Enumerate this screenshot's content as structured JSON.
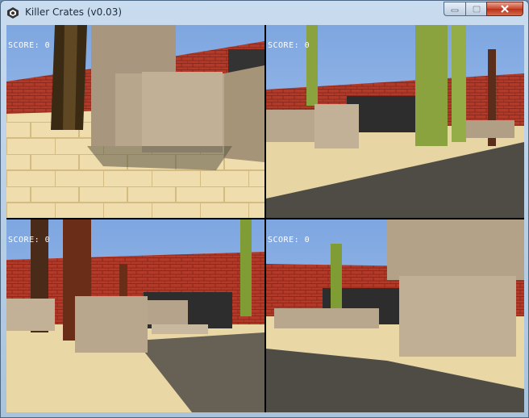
{
  "window": {
    "title": "Killer Crates (v0.03)",
    "icons": {
      "app": "unity-logo-icon",
      "minimize": "minimize-icon",
      "maximize": "maximize-icon",
      "close": "close-icon"
    }
  },
  "viewports": [
    {
      "score_text": "SCORE: 0"
    },
    {
      "score_text": "SCORE: 0"
    },
    {
      "score_text": "SCORE: 0"
    },
    {
      "score_text": "SCORE: 0"
    }
  ],
  "colors": {
    "sky": "#86aee6",
    "brick": "#b23a28",
    "sand": "#ead7a6",
    "crate": "#b5a48b",
    "cactus": "#7f9c35",
    "dark_wall": "#2d2d2d",
    "close_button": "#c8452a"
  }
}
